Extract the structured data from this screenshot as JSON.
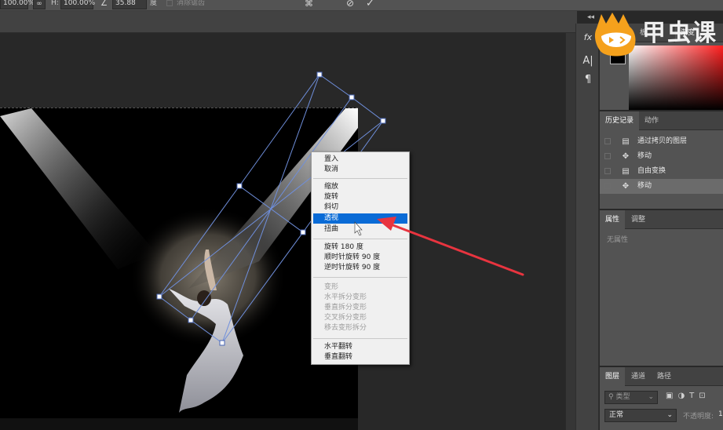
{
  "options_bar": {
    "width_value": "100.00%",
    "link_icon": "link-icon",
    "height_label": "H:",
    "height_value": "100.00%",
    "angle_icon": "angle-icon",
    "angle_value": "35.88",
    "angle_unit": "度",
    "antialias_label": "消除锯齿",
    "warp_icon": "warp-icon",
    "cancel_icon": "cancel-icon",
    "commit_icon": "commit-icon"
  },
  "tab_strip": {
    "collapse_label": "◂◂"
  },
  "icon_column": {
    "buttons": [
      "fx",
      "A|",
      "¶"
    ]
  },
  "color_panel": {
    "tab_partial": "板",
    "tab_gradient": "渐变"
  },
  "history_panel": {
    "tabs": [
      "历史记录",
      "动作"
    ],
    "active_tab": "历史记录",
    "items": [
      {
        "label": "通过拷贝的图层",
        "icon": "document-icon",
        "selected": false
      },
      {
        "label": "移动",
        "icon": "move-icon",
        "selected": false
      },
      {
        "label": "自由变换",
        "icon": "document-icon",
        "selected": false
      },
      {
        "label": "移动",
        "icon": "move-icon",
        "selected": true
      }
    ]
  },
  "properties_panel": {
    "tabs": [
      "属性",
      "调整"
    ],
    "active_tab": "属性",
    "empty_text": "无属性"
  },
  "layers_panel": {
    "tabs": [
      "图层",
      "通道",
      "路径"
    ],
    "active_tab": "图层",
    "filter_placeholder": "类型",
    "blend_mode": "正常",
    "opacity_label": "不透明度:",
    "opacity_value": "1"
  },
  "context_menu": {
    "groups": [
      [
        {
          "label": "置入",
          "disabled": false
        },
        {
          "label": "取消",
          "disabled": false
        }
      ],
      [
        {
          "label": "缩放",
          "disabled": false
        },
        {
          "label": "旋转",
          "disabled": false
        },
        {
          "label": "斜切",
          "disabled": false
        },
        {
          "label": "透视",
          "disabled": false,
          "highlighted": true
        },
        {
          "label": "扭曲",
          "disabled": false
        }
      ],
      [
        {
          "label": "旋转 180 度",
          "disabled": false
        },
        {
          "label": "顺时针旋转 90 度",
          "disabled": false
        },
        {
          "label": "逆时针旋转 90 度",
          "disabled": false
        }
      ],
      [
        {
          "label": "变形",
          "disabled": true
        },
        {
          "label": "水平拆分变形",
          "disabled": true
        },
        {
          "label": "垂直拆分变形",
          "disabled": true
        },
        {
          "label": "交叉拆分变形",
          "disabled": true
        },
        {
          "label": "移去变形拆分",
          "disabled": true
        }
      ],
      [
        {
          "label": "水平翻转",
          "disabled": false
        },
        {
          "label": "垂直翻转",
          "disabled": false
        }
      ]
    ]
  },
  "watermark": {
    "text": "甲虫课",
    "logo_name": "beetle-logo"
  },
  "colors": {
    "accent": "#0a6bd6",
    "arrow": "#e8343f",
    "transform_box": "#6f8fdc"
  }
}
